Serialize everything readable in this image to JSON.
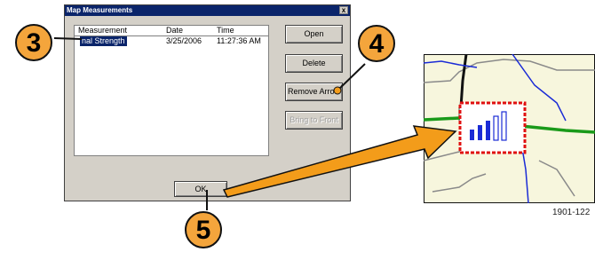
{
  "dialog": {
    "title": "Map Measurements",
    "close_glyph": "x",
    "columns": [
      "Measurement",
      "Date",
      "Time"
    ],
    "rows": [
      {
        "measurement": "nal Strength",
        "date": "3/25/2006",
        "time": "11:27:36 AM",
        "selected": true
      }
    ],
    "buttons": {
      "open": "Open",
      "delete": "Delete",
      "remove_arrow": "Remove Arrow",
      "bring_to_front": "Bring to Front"
    },
    "ok": "OK"
  },
  "callouts": {
    "c3": "3",
    "c4": "4",
    "c5": "5"
  },
  "figure_id": "1901-122",
  "colors": {
    "titlebar": "#0a246a",
    "dialog_face": "#d4d0c8",
    "callout_fill": "#f4a53c",
    "arrow_fill": "#f39c1a",
    "map_bg": "#f7f6dd",
    "road_green": "#1a9a1a",
    "road_blue": "#1a2bd6",
    "marker_border": "#e01010"
  },
  "map_marker": {
    "icon": "signal-strength-bars-icon",
    "filled_bars": 3,
    "total_bars": 5
  }
}
